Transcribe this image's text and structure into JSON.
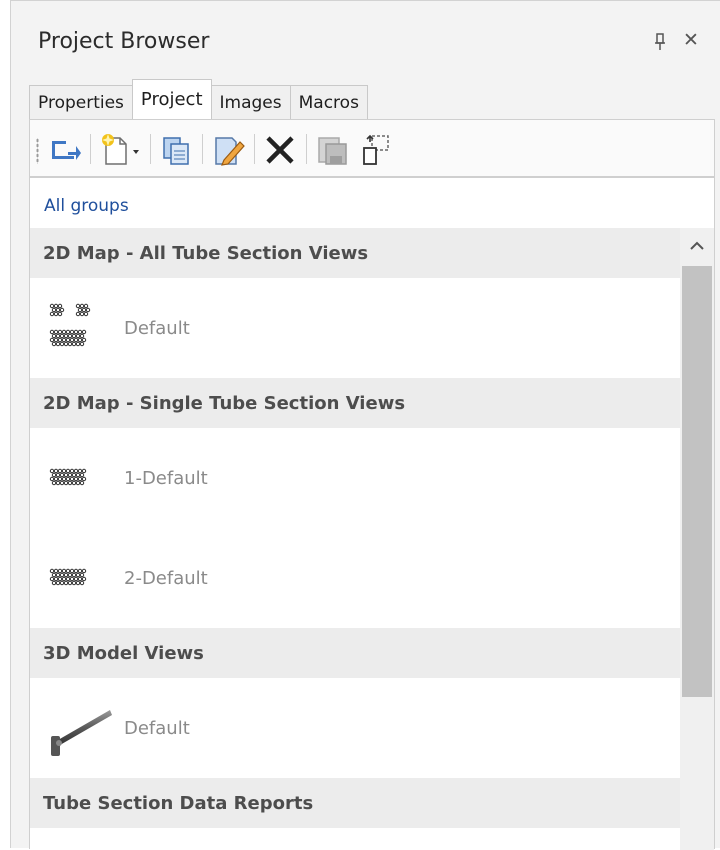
{
  "panel": {
    "title": "Project Browser",
    "pin_icon": "pin-icon",
    "close_icon": "close-icon",
    "close_glyph": "✕"
  },
  "tabs": [
    {
      "label": "Properties",
      "active": false
    },
    {
      "label": "Project",
      "active": true
    },
    {
      "label": "Images",
      "active": false
    },
    {
      "label": "Macros",
      "active": false
    }
  ],
  "toolbar": {
    "buttons": [
      {
        "name": "import-view-icon",
        "enabled": true
      },
      {
        "name": "new-view-icon",
        "enabled": true
      },
      {
        "name": "copy-icon",
        "enabled": true
      },
      {
        "name": "edit-icon",
        "enabled": true
      },
      {
        "name": "delete-icon",
        "enabled": true
      },
      {
        "name": "save-icon",
        "enabled": false
      },
      {
        "name": "rename-icon",
        "enabled": true
      }
    ]
  },
  "breadcrumb": "All groups",
  "groups": [
    {
      "title": "2D Map - All Tube Section Views",
      "items": [
        {
          "label": "Default",
          "thumb": "all-tube-sections-thumb"
        }
      ]
    },
    {
      "title": "2D Map - Single Tube Section Views",
      "items": [
        {
          "label": "1-Default",
          "thumb": "single-tube-section-thumb"
        },
        {
          "label": "2-Default",
          "thumb": "single-tube-section-thumb"
        }
      ]
    },
    {
      "title": "3D Model Views",
      "items": [
        {
          "label": "Default",
          "thumb": "3d-tube-model-thumb"
        }
      ]
    },
    {
      "title": "Tube Section Data Reports",
      "items": []
    }
  ],
  "colors": {
    "link": "#1f4f9c",
    "header_bg": "#ececec",
    "item_text": "#8a8a8a"
  }
}
